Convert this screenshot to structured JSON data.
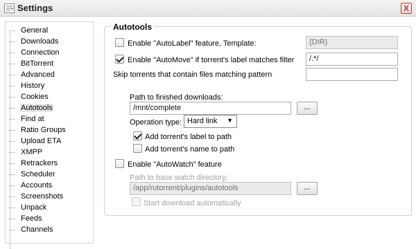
{
  "window": {
    "title": "Settings",
    "close_label": "X"
  },
  "nav": {
    "items": [
      "General",
      "Downloads",
      "Connection",
      "BitTorrent",
      "Advanced",
      "History",
      "Cookies",
      "Autotools",
      "Find at",
      "Ratio Groups",
      "Upload ETA",
      "XMPP",
      "Retrackers",
      "Scheduler",
      "Accounts",
      "Screenshots",
      "Unpack",
      "Feeds",
      "Channels"
    ],
    "selected": "Autotools"
  },
  "autotools": {
    "section_title": "Autotools",
    "autolabel": {
      "label": "Enable \"AutoLabel\" feature, Template:",
      "checked": false,
      "template_value": "{DIR}"
    },
    "automove": {
      "label": "Enable \"AutoMove\" if torrent's label matches filter",
      "checked": true,
      "filter_value": "/.*/"
    },
    "skip": {
      "label": "Skip torrents that contain files matching pattern",
      "value": ""
    },
    "finished": {
      "label": "Path to finished downloads:",
      "value": "/mnt/complete",
      "browse_label": "...",
      "operation_label": "Operation type:",
      "operation_value": "Hard link",
      "add_label_to_path": {
        "label": "Add torrent's label to path",
        "checked": true
      },
      "add_name_to_path": {
        "label": "Add torrent's name to path",
        "checked": false
      }
    },
    "autowatch": {
      "label": "Enable \"AutoWatch\" feature",
      "checked": false,
      "path_label": "Path to base watch directory:",
      "path_value": "/app/rutorrent/plugins/autotools",
      "browse_label": "...",
      "start_auto": {
        "label": "Start download automatically",
        "checked": false
      }
    }
  }
}
